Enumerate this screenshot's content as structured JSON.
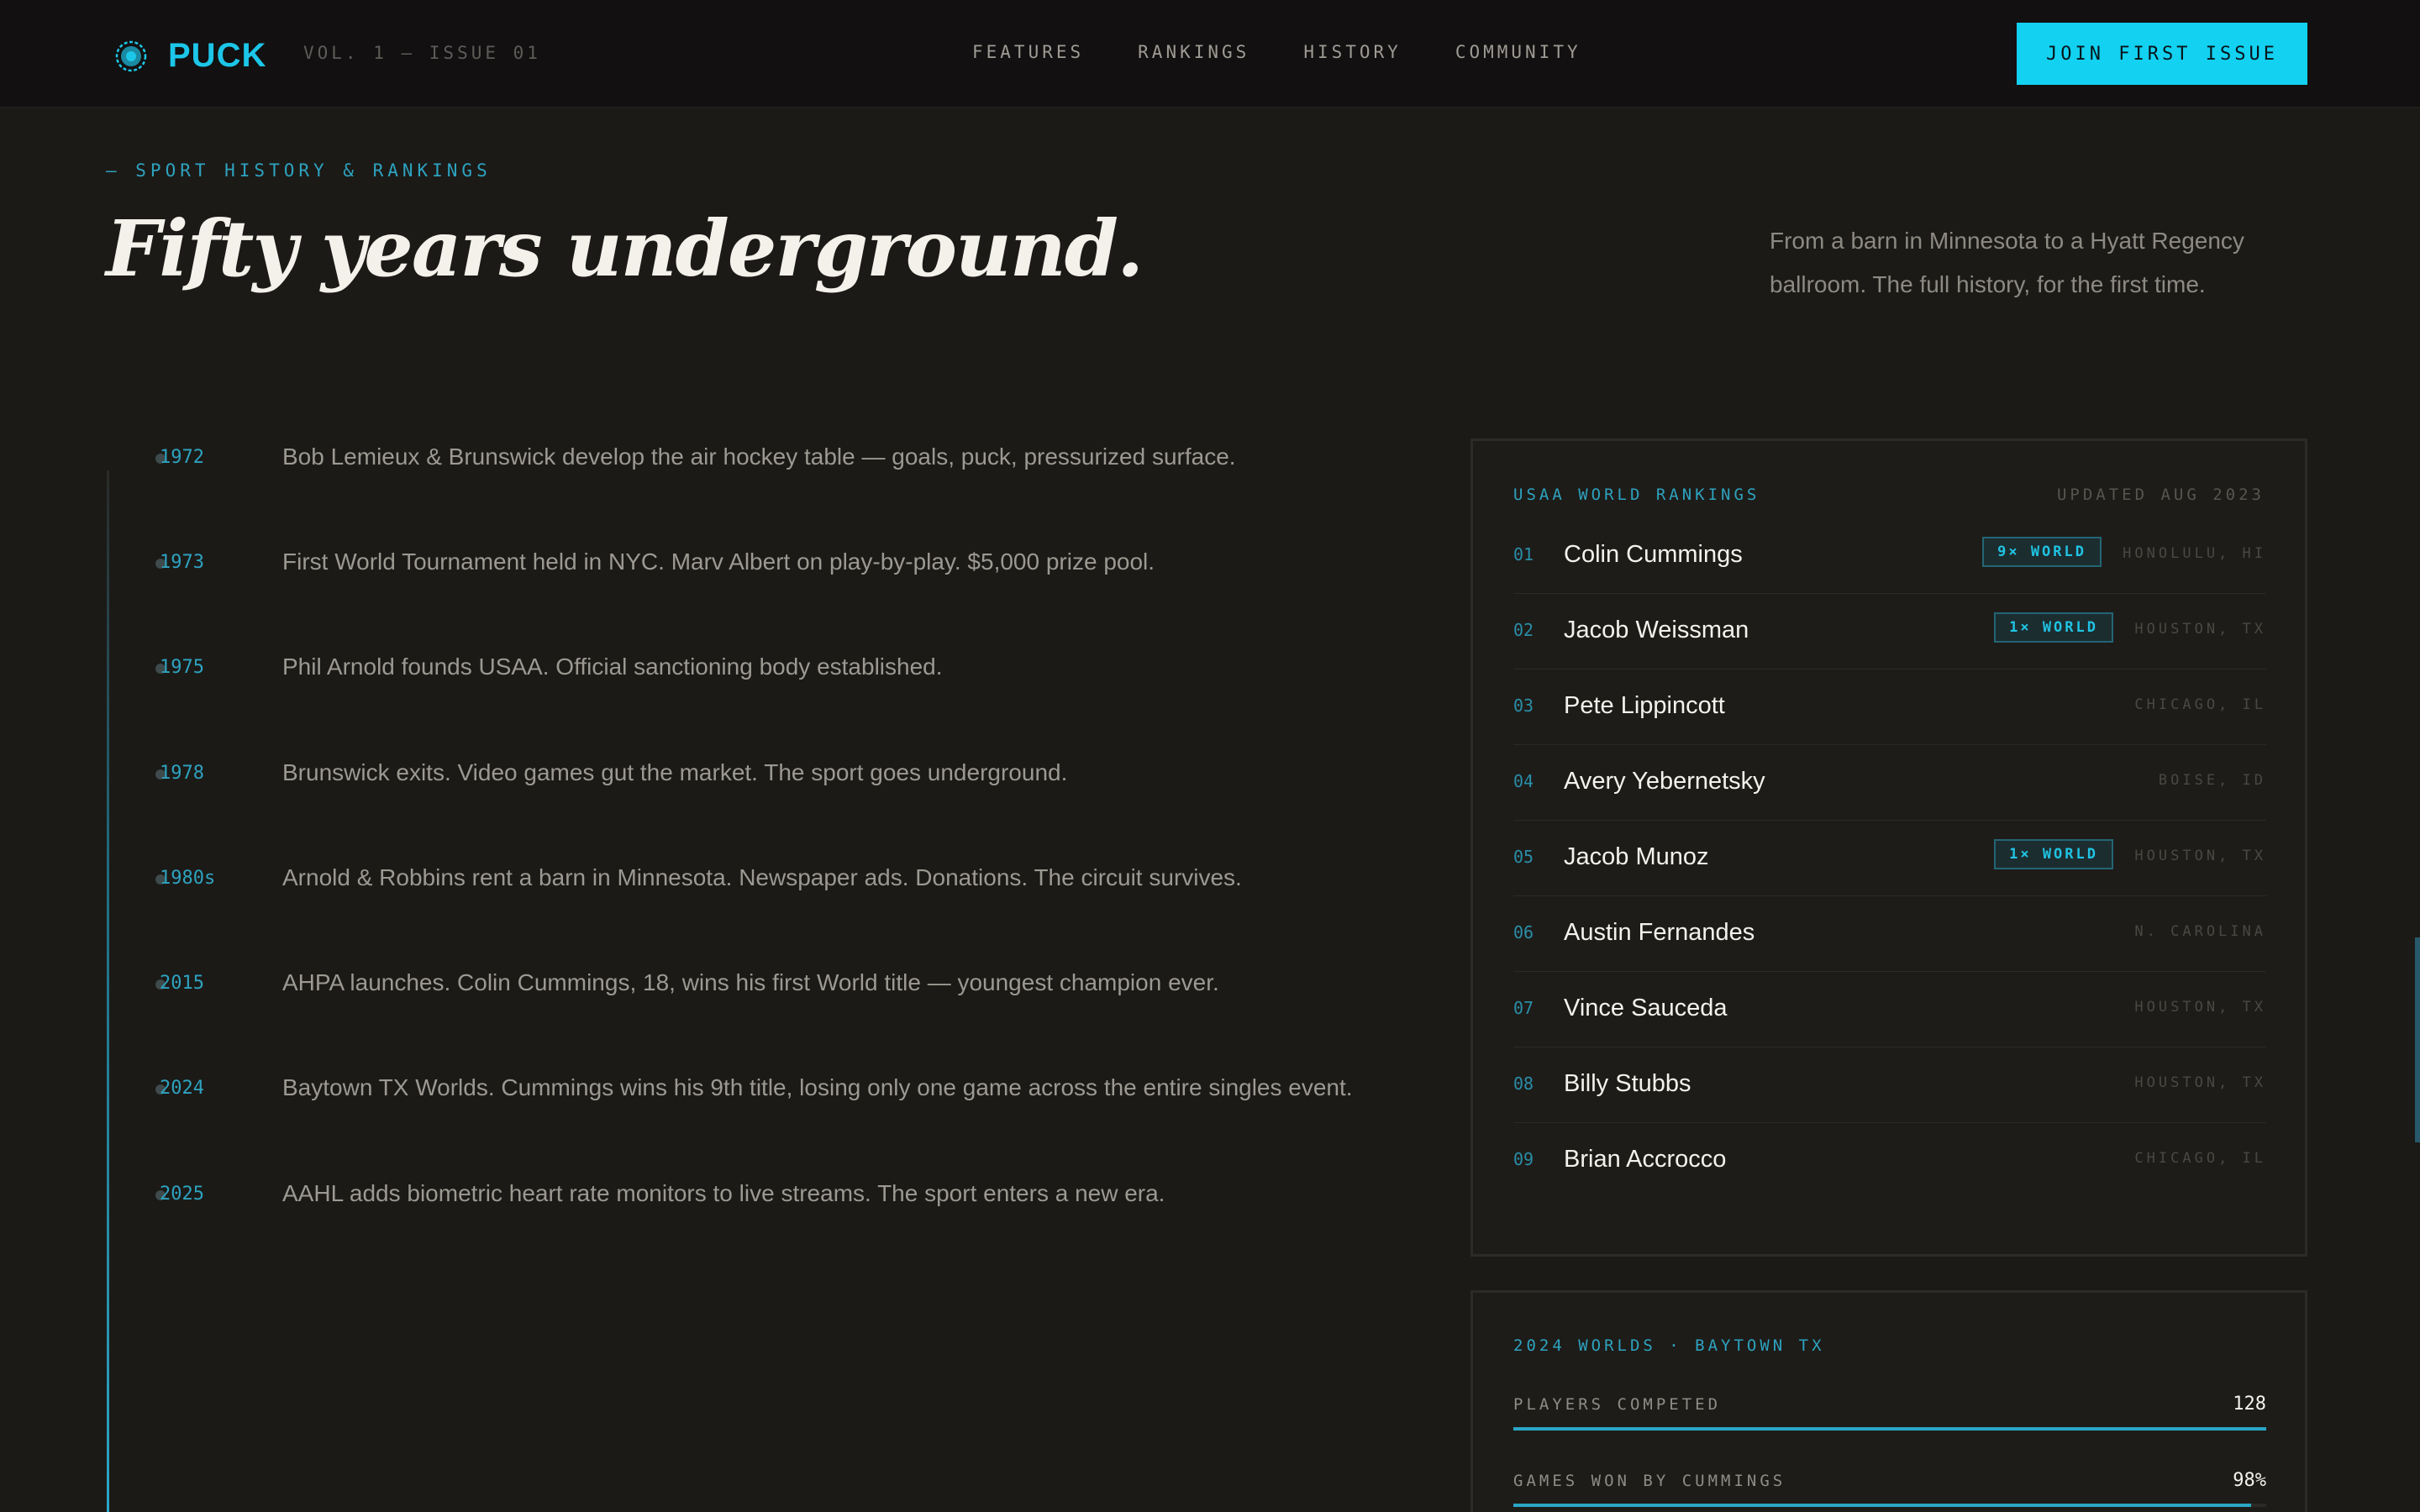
{
  "header": {
    "brand": "PUCK",
    "issue": "VOL. 1 — ISSUE 01",
    "nav": [
      "FEATURES",
      "RANKINGS",
      "HISTORY",
      "COMMUNITY"
    ],
    "cta": "JOIN FIRST ISSUE",
    "brand_color": "#1cc6e8",
    "cta_color": "#13d1f1"
  },
  "hero": {
    "eyebrow": "— SPORT HISTORY & RANKINGS",
    "headline": "Fifty years underground.",
    "intro": "From a barn in Minnesota to a Hyatt Regency ballroom. The full history, for the first time."
  },
  "timeline": [
    {
      "year": "1972",
      "text": "Bob Lemieux & Brunswick develop the air hockey table — goals, puck, pressurized surface."
    },
    {
      "year": "1973",
      "text": "First World Tournament held in NYC. Marv Albert on play-by-play. $5,000 prize pool."
    },
    {
      "year": "1975",
      "text": "Phil Arnold founds USAA. Official sanctioning body established."
    },
    {
      "year": "1978",
      "text": "Brunswick exits. Video games gut the market. The sport goes underground."
    },
    {
      "year": "1980s",
      "text": "Arnold & Robbins rent a barn in Minnesota. Newspaper ads. Donations. The circuit survives."
    },
    {
      "year": "2015",
      "text": "AHPA launches. Colin Cummings, 18, wins his first World title — youngest champion ever."
    },
    {
      "year": "2024",
      "text": "Baytown TX Worlds. Cummings wins his 9th title, losing only one game across the entire singles event."
    },
    {
      "year": "2025",
      "text": "AAHL adds biometric heart rate monitors to live streams. The sport enters a new era."
    }
  ],
  "rankings": {
    "label": "USAA WORLD RANKINGS",
    "updated": "UPDATED AUG 2023",
    "players": [
      {
        "rank": "01",
        "name": "Colin Cummings",
        "badge": "9× WORLD",
        "location": "HONOLULU, HI"
      },
      {
        "rank": "02",
        "name": "Jacob Weissman",
        "badge": "1× WORLD",
        "location": "HOUSTON, TX"
      },
      {
        "rank": "03",
        "name": "Pete Lippincott",
        "badge": "",
        "location": "CHICAGO, IL"
      },
      {
        "rank": "04",
        "name": "Avery Yebernetsky",
        "badge": "",
        "location": "BOISE, ID"
      },
      {
        "rank": "05",
        "name": "Jacob Munoz",
        "badge": "1× WORLD",
        "location": "HOUSTON, TX"
      },
      {
        "rank": "06",
        "name": "Austin Fernandes",
        "badge": "",
        "location": "N. CAROLINA"
      },
      {
        "rank": "07",
        "name": "Vince Sauceda",
        "badge": "",
        "location": "HOUSTON, TX"
      },
      {
        "rank": "08",
        "name": "Billy Stubbs",
        "badge": "",
        "location": "HOUSTON, TX"
      },
      {
        "rank": "09",
        "name": "Brian Accrocco",
        "badge": "",
        "location": "CHICAGO, IL"
      }
    ]
  },
  "worlds": {
    "label": "2024 WORLDS · BAYTOWN TX",
    "stats": [
      {
        "label": "PLAYERS COMPETED",
        "value": "128",
        "fill": 1.0
      },
      {
        "label": "GAMES WON BY CUMMINGS",
        "value": "98%",
        "fill": 0.98
      }
    ]
  }
}
